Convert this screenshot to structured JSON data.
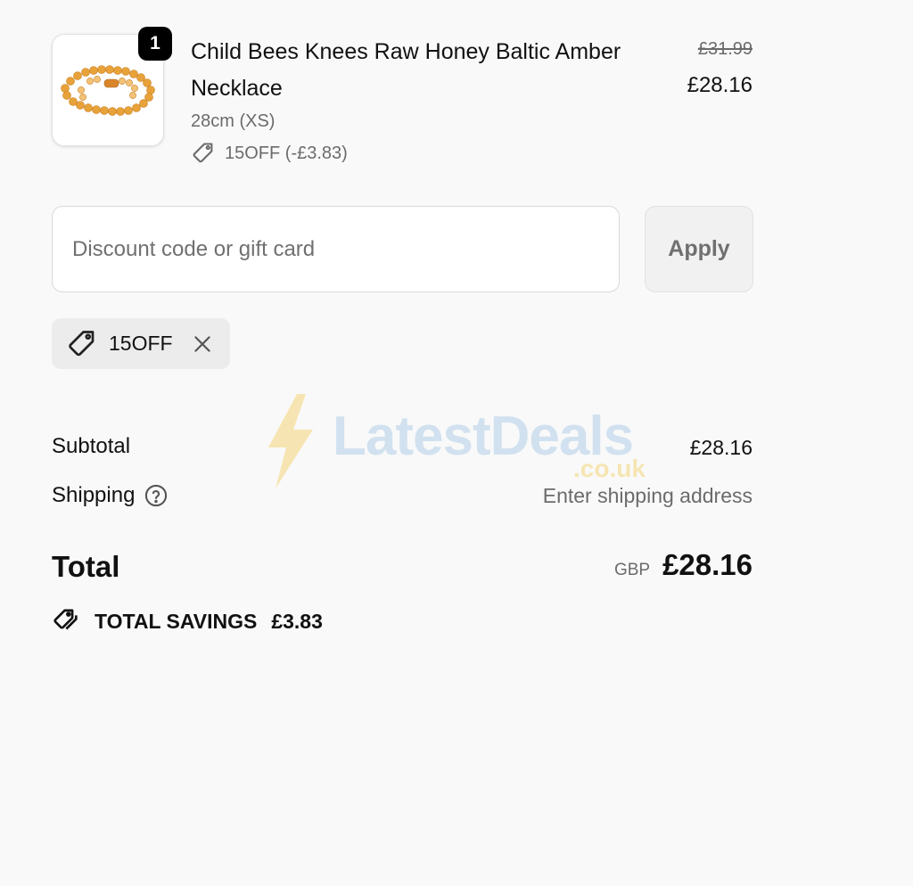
{
  "line_item": {
    "quantity": "1",
    "title": "Child Bees Knees Raw Honey Baltic Amber Necklace",
    "variant": "28cm (XS)",
    "discount": "15OFF (-£3.83)",
    "original_price": "£31.99",
    "price": "£28.16",
    "image_icon": "amber-necklace-image"
  },
  "discount_form": {
    "placeholder": "Discount code or gift card",
    "apply_label": "Apply"
  },
  "applied_code": {
    "code": "15OFF",
    "remove_icon": "close-icon"
  },
  "watermark": {
    "brand": "LatestDeals",
    "domain": ".co.uk"
  },
  "summary": {
    "subtotal_label": "Subtotal",
    "subtotal_value": "£28.16",
    "shipping_label": "Shipping",
    "shipping_value": "Enter shipping address",
    "total_label": "Total",
    "currency": "GBP",
    "total_value": "£28.16",
    "savings_label": "TOTAL SAVINGS",
    "savings_value": "£3.83"
  },
  "colors": {
    "background": "#f9f9f9",
    "text": "#111111",
    "muted": "#6b6b6b",
    "badge": "#000000",
    "chip": "#ececec"
  }
}
